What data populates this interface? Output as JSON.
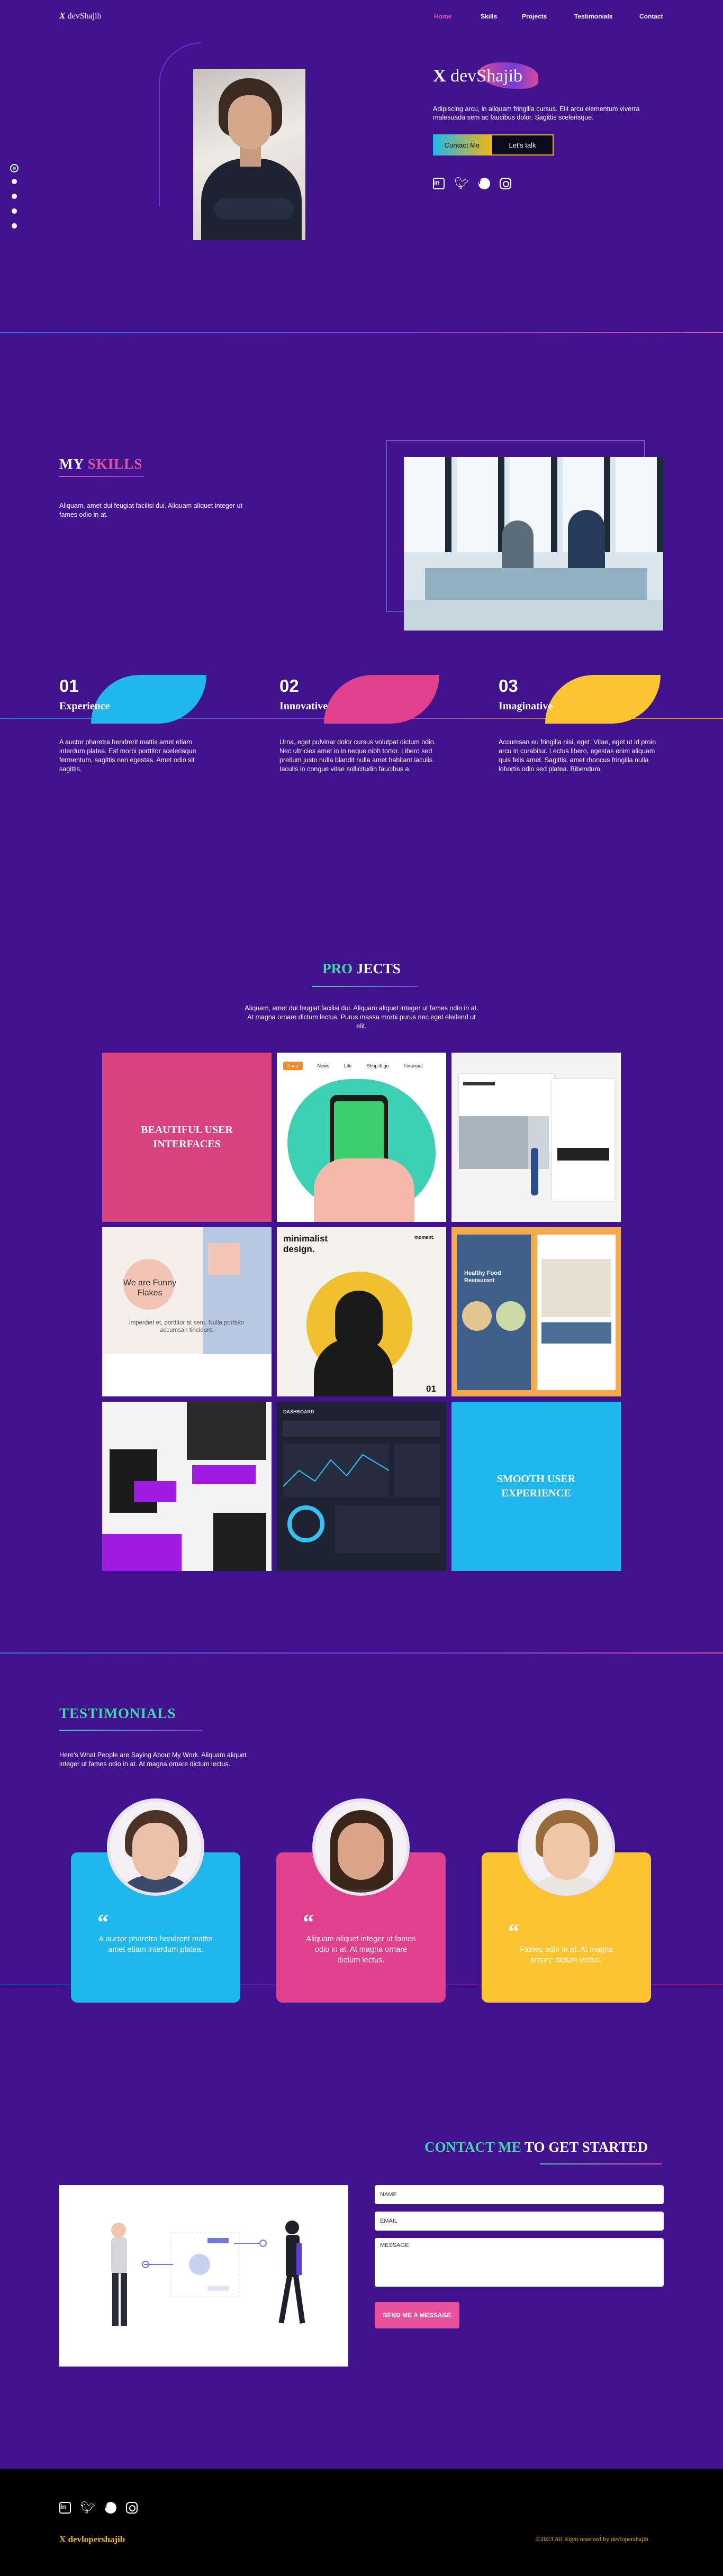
{
  "nav": {
    "logo_x": "X",
    "logo_name": "devShajib",
    "links": [
      "Home",
      "Skills",
      "Projects",
      "Testimonials",
      "Contact"
    ]
  },
  "hero": {
    "title_x": "X",
    "title_name": "devShajib",
    "description": "Adipiscing arcu, in aliquam fringilla cursus. Elit arcu elementum viverra malesuada sem ac faucibus dolor. Sagittis scelerisque.",
    "contact_label": "Contact Me",
    "talk_label": "Let's talk",
    "social": [
      "linkedin-icon",
      "twitter-icon",
      "facebook-icon",
      "instagram-icon"
    ]
  },
  "skills": {
    "title_white": "MY",
    "title_pink": "SKILLS",
    "description": "Aliquam, amet dui feugiat facilisi dui. Aliquam aliquet integer ut fames odio in at.",
    "items": [
      {
        "num": "01",
        "name": "Experience",
        "color": "#1fb8ec",
        "description": "A auctor pharetra hendrerit mattis amet etiam interdum platea. Est morbi porttitor scelerisque fermentum, sagittis non egestas. Amet odio sit sagittis,"
      },
      {
        "num": "02",
        "name": "Innovative",
        "color": "#e0418e",
        "description": "Urna, eget pulvinar dolor cursus volutpat dictum odio. Nec ultricies amet in in neque nibh tortor. Libero sed pretium justo nulla blandit nulla amet habitant iaculis. Iaculis in congue vitae sollicitudin faucibus a"
      },
      {
        "num": "03",
        "name": "Imaginative",
        "color": "#fcc430",
        "description": "Accumsan eu fringilla nisi, eget. Vitae, eget ut id proin arcu in curabitur. Lectus libero, egestas enim aliquam quis felis amet. Sagittis, amet rhoncus fringilla nulla lobortis odio sed platea. Bibendum."
      }
    ]
  },
  "projects": {
    "title_teal": "PRO",
    "title_white": "JECTS",
    "description": "Aliquam, amet dui feugiat facilisi dui. Aliquam aliquet integer ut fames odio in at. At magna ornare dictum lectus. Purus massa morbi purus nec eget eleifend ut elit.",
    "tile1": "BEAUTIFUL USER INTERFACES",
    "tile9": "SMOOTH USER EXPERIENCE",
    "phone_tabs": [
      "Food",
      "News",
      "Life",
      "Shop & go",
      "Financial"
    ],
    "flakes_title": "We are Funny Flakes",
    "flakes_text": "imperdiet et, porttitor at sem. Nulla porttitor accumsan tincidunt.",
    "minimalist_title": "minimalist design.",
    "minimalist_sub": "moment.",
    "minimalist_num": "01",
    "food_title": "Healthy Food Restaurant",
    "dash_title": "DASHBOARD"
  },
  "testimonials": {
    "title": "TESTIMONIALS",
    "description": "Here's What People are Saying About My Work. Aliquam aliquet integer ut fames odio in at. At magna ornare dictum lectus.",
    "cards": [
      {
        "quote": "A auctor pharetra hendrerit mattis amet etiam interdum platea.",
        "color": "#1fb8ec"
      },
      {
        "quote": "Aliquam aliquet integer ut fames odio in at. At magna ornare dictum lectus.",
        "color": "#e0418e"
      },
      {
        "quote": "Fames odio in at. At magna ornare dictum lectus.",
        "color": "#fcc430"
      }
    ],
    "quote_mark": "“"
  },
  "contact": {
    "title_teal": "CONTACT ME",
    "title_white": "TO GET STARTED",
    "name_placeholder": "NAME",
    "email_placeholder": "EMAIL",
    "message_placeholder": "MESSAGE",
    "send_label": "SEND ME A MESSAGE"
  },
  "footer": {
    "brand": "X devlopershajib",
    "copyright": "©2023 All Right reserved by devlopershajib"
  }
}
